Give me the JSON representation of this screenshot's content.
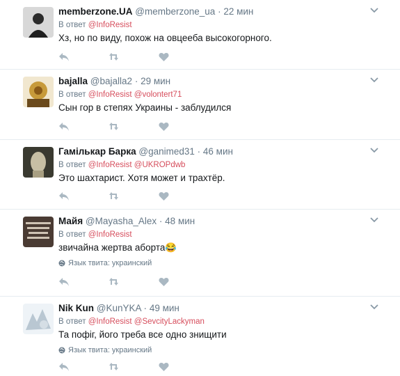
{
  "reply_prefix": "В ответ",
  "lang_label": "Язык твита: украинский",
  "colors": {
    "accent_mention": "#d64d5c",
    "muted": "#657786",
    "icon": "#aab8c2"
  },
  "tweets": [
    {
      "fullname": "memberzone.UA",
      "username": "@memberzone_ua",
      "time": "22 мин",
      "mentions": [
        "@InfoResist"
      ],
      "text": "Хз, но по виду, похож на овцееба высокогорного.",
      "lang": false
    },
    {
      "fullname": "bajalla",
      "username": "@bajalla2",
      "time": "29 мин",
      "mentions": [
        "@InfoResist",
        "@volontert71"
      ],
      "text": "Сын гор в степях Украины - заблудился",
      "lang": false
    },
    {
      "fullname": "Гамількар Барка",
      "username": "@ganimed31",
      "time": "46 мин",
      "mentions": [
        "@InfoResist",
        "@UKROPdwb"
      ],
      "text": "Это шахтарист. Хотя может и трахтёр.",
      "lang": false
    },
    {
      "fullname": "Майя",
      "username": "@Mayasha_Alex",
      "time": "48 мин",
      "mentions": [
        "@InfoResist"
      ],
      "text": "звичайна жертва аборта",
      "emoji": "😂",
      "lang": true
    },
    {
      "fullname": "Nik Kun",
      "username": "@KunYKA",
      "time": "49 мин",
      "mentions": [
        "@InfoResist",
        "@SevcityLackyman"
      ],
      "text": "Та пофіг, його треба все одно знищити",
      "lang": true
    }
  ]
}
